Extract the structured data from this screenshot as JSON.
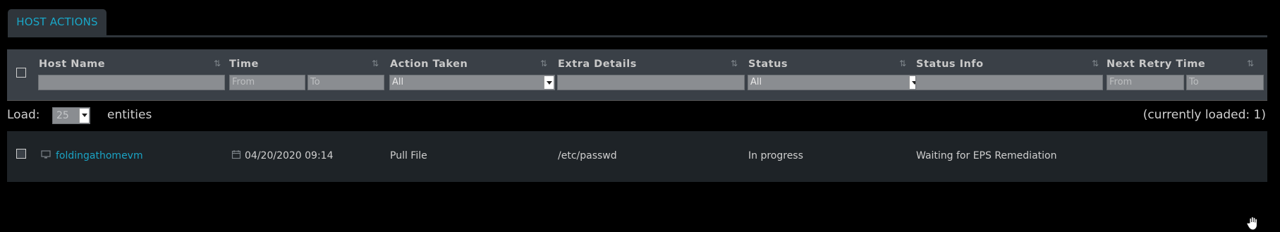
{
  "tab": {
    "label": "HOST ACTIONS"
  },
  "columns": [
    {
      "key": "host_name",
      "label": "Host Name"
    },
    {
      "key": "time",
      "label": "Time"
    },
    {
      "key": "action_taken",
      "label": "Action Taken"
    },
    {
      "key": "extra_details",
      "label": "Extra Details"
    },
    {
      "key": "status",
      "label": "Status"
    },
    {
      "key": "status_info",
      "label": "Status Info"
    },
    {
      "key": "next_retry_time",
      "label": "Next Retry Time"
    }
  ],
  "filters": {
    "host_name": "",
    "time_from_placeholder": "From",
    "time_to_placeholder": "To",
    "action_taken": "All",
    "extra_details": "",
    "status": "All",
    "status_info": "",
    "next_retry_from_placeholder": "From",
    "next_retry_to_placeholder": "To"
  },
  "load": {
    "label": "Load:",
    "value": "25",
    "suffix": "entities",
    "loaded_text": "(currently loaded: 1)"
  },
  "rows": [
    {
      "host_name": "foldingathomevm",
      "host_icon": "monitor-icon",
      "time": "04/20/2020 09:14",
      "time_icon": "calendar-icon",
      "action_taken": "Pull File",
      "extra_details": "/etc/passwd",
      "status": "In progress",
      "status_info": "Waiting for EPS Remediation",
      "next_retry_time": ""
    }
  ],
  "colors": {
    "background": "#000000",
    "header_bg": "#3a4047",
    "row_bg": "#1e2327",
    "accent": "#1aa3c4"
  }
}
